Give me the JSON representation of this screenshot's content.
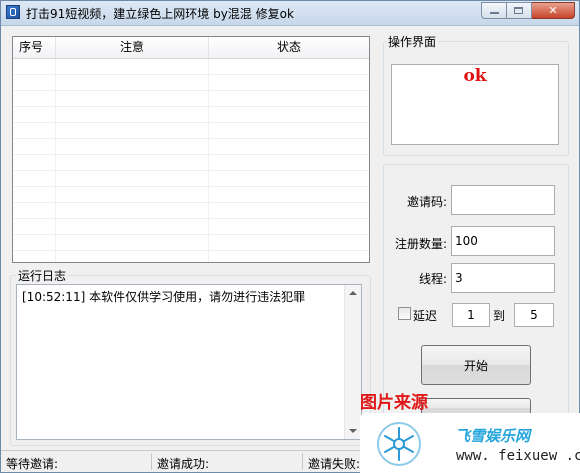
{
  "window": {
    "title": "打击91短视频，建立绿色上网环境    by混混 修复ok"
  },
  "list": {
    "columns": [
      "序号",
      "注意",
      "状态"
    ]
  },
  "log": {
    "label": "运行日志",
    "lines": [
      "[10:52:11] 本软件仅供学习使用，请勿进行违法犯罪"
    ]
  },
  "panel": {
    "label": "操作界面",
    "status_text": "ok",
    "invite_code_label": "邀请码:",
    "invite_code_value": "",
    "register_count_label": "注册数量:",
    "register_count_value": "100",
    "threads_label": "线程:",
    "threads_value": "3",
    "delay_label": "延迟",
    "delay_checked": false,
    "delay_from": "1",
    "delay_to_label": "到",
    "delay_to": "5",
    "start_button": "开始"
  },
  "statusbar": {
    "waiting": "等待邀请:",
    "success": "邀请成功:",
    "failed": "邀请失败:"
  },
  "watermark": {
    "source_label": "图片来源",
    "brand": "飞雪娱乐网",
    "url": "www. feixuew .com",
    "logo_icon": "snowflake-logo-icon"
  },
  "colors": {
    "ok_text": "#e01010",
    "watermark_red": "#e01818",
    "brand_blue": "#27a6dd"
  }
}
